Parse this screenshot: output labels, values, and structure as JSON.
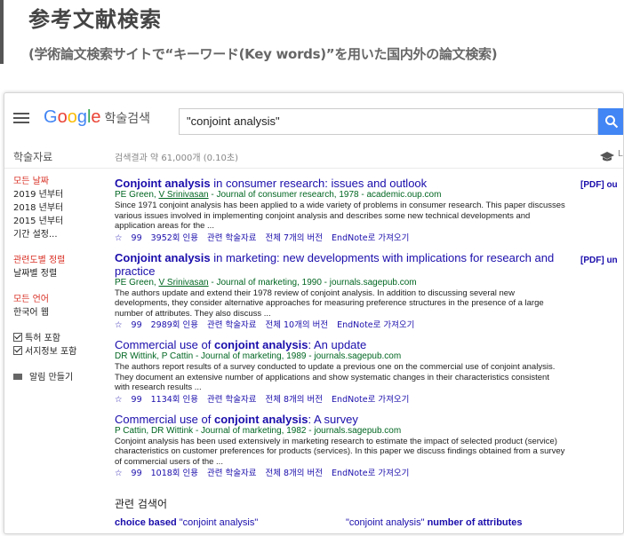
{
  "heading": {
    "title": "参考文献検索",
    "subtitle": "(学術論文検索サイトで“キーワード(Key words)”を用いた国内外の論文検索)"
  },
  "app": {
    "logo_parts": [
      "G",
      "o",
      "o",
      "g",
      "l",
      "e"
    ],
    "logo_suffix": "학술검색",
    "search_value": "\"conjoint analysis\"",
    "subnav_label": "학술자료",
    "stats": "검색결과 약 61,000개 (0.10초)",
    "more_label": "L"
  },
  "sidebar": {
    "time_filters": [
      "모든 날짜",
      "2019 년부터",
      "2018 년부터",
      "2015 년부터",
      "기간 설정..."
    ],
    "sort_options": [
      "관련도별 정렬",
      "날짜별 정렬"
    ],
    "language_options": [
      "모든 언어",
      "한국어 웹"
    ],
    "checkboxes": [
      "특허 포함",
      "서지정보 포함"
    ],
    "alert": "알림 만들기"
  },
  "results": [
    {
      "title_bold": "Conjoint analysis",
      "title_rest": " in consumer research: issues and outlook",
      "authors_a": "PE Green, ",
      "authors_link": "V Srinivasan",
      "meta_rest": " - Journal of consumer research, 1978 - academic.oup.com",
      "snippet": "Since 1971 conjoint analysis has been applied to a wide variety of problems in consumer research. This paper discusses various issues involved in implementing conjoint analysis and describes some new technical developments and application areas for the ...",
      "links": [
        "☆",
        "99",
        "3952회 인용",
        "관련 학술자료",
        "전체 7개의 버전",
        "EndNote로 가져오기"
      ],
      "pdf": "[PDF] ou"
    },
    {
      "title_bold": "Conjoint analysis",
      "title_rest": " in marketing: new developments with implications for research and practice",
      "authors_a": "PE Green, ",
      "authors_link": "V Srinivasan",
      "meta_rest": " - Journal of marketing, 1990 - journals.sagepub.com",
      "snippet": "The authors update and extend their 1978 review of conjoint analysis. In addition to discussing several new developments, they consider alternative approaches for measuring preference structures in the presence of a large number of attributes. They also discuss ...",
      "links": [
        "☆",
        "99",
        "2989회 인용",
        "관련 학술자료",
        "전체 10개의 버전",
        "EndNote로 가져오기"
      ],
      "pdf": "[PDF] un"
    },
    {
      "title_pre": "Commercial use of ",
      "title_bold": "conjoint analysis",
      "title_rest": ": An update",
      "authors_a": "DR Wittink, P Cattin",
      "authors_link": "",
      "meta_rest": " - Journal of marketing, 1989 - journals.sagepub.com",
      "snippet": "The authors report results of a survey conducted to update a previous one on the commercial use of conjoint analysis. They document an extensive number of applications and show systematic changes in their characteristics consistent with research results ...",
      "links": [
        "☆",
        "99",
        "1134회 인용",
        "관련 학술자료",
        "전체 8개의 버전",
        "EndNote로 가져오기"
      ],
      "pdf": ""
    },
    {
      "title_pre": "Commercial use of ",
      "title_bold": "conjoint analysis",
      "title_rest": ": A survey",
      "authors_a": "P Cattin, DR Wittink",
      "authors_link": "",
      "meta_rest": " - Journal of marketing, 1982 - journals.sagepub.com",
      "snippet": "Conjoint analysis has been used extensively in marketing research to estimate the impact of selected product (service) characteristics on customer preferences for products (services). In this paper we discuss findings obtained from a survey of commercial users of the ...",
      "links": [
        "☆",
        "99",
        "1018회 인용",
        "관련 학술자료",
        "전체 8개의 버전",
        "EndNote로 가져오기"
      ],
      "pdf": ""
    }
  ],
  "related": {
    "title": "관련 검색어",
    "item1_bold": "choice based",
    "item1_rest": " \"conjoint analysis\"",
    "item2_pre": "\"conjoint analysis\" ",
    "item2_bold": "number of attributes"
  },
  "colors": {
    "link": "#1a0dab",
    "url_green": "#006621",
    "accent_red": "#d93025",
    "search_blue": "#4285f4"
  },
  "icons": [
    "hamburger-menu-icon",
    "search-icon",
    "graduation-cap-icon",
    "star-icon",
    "quote-icon",
    "mail-icon",
    "checkbox-checked-icon"
  ]
}
